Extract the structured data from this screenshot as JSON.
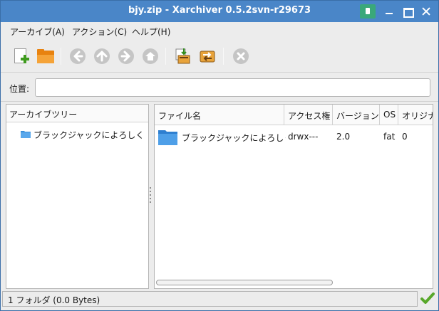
{
  "window": {
    "title": "bjy.zip - Xarchiver 0.5.2svn-r29673"
  },
  "menu": {
    "items": [
      "アーカイブ(A)",
      "アクション(C)",
      "ヘルプ(H)"
    ]
  },
  "toolbar": {
    "buttons": [
      {
        "name": "new-archive",
        "icon": "new-document-plus-icon",
        "enabled": true
      },
      {
        "name": "open-archive",
        "icon": "folder-open-icon",
        "enabled": true
      },
      {
        "name": "back",
        "icon": "arrow-left-icon",
        "enabled": false
      },
      {
        "name": "up",
        "icon": "arrow-up-icon",
        "enabled": false
      },
      {
        "name": "forward",
        "icon": "arrow-right-icon",
        "enabled": false
      },
      {
        "name": "home",
        "icon": "home-icon",
        "enabled": false
      },
      {
        "name": "extract",
        "icon": "extract-icon",
        "enabled": true
      },
      {
        "name": "convert",
        "icon": "convert-icon",
        "enabled": true
      },
      {
        "name": "stop",
        "icon": "stop-icon",
        "enabled": false
      }
    ]
  },
  "location": {
    "label": "位置:",
    "value": ""
  },
  "tree": {
    "header": "アーカイブツリー",
    "items": [
      {
        "label": "ブラックジャックによろしく",
        "icon": "folder-icon"
      }
    ]
  },
  "filelist": {
    "columns": [
      "ファイル名",
      "アクセス権",
      "バージョン",
      "OS",
      "オリジナル"
    ],
    "rows": [
      {
        "name": "ブラックジャックによろしく",
        "permissions": "drwx---",
        "version": "2.0",
        "os": "fat",
        "original": "0",
        "icon": "folder-icon"
      }
    ]
  },
  "status": {
    "text": "1 フォルダ  (0.0 Bytes)",
    "icon": "checkmark-icon"
  },
  "colors": {
    "titlebar": "#4a86c8",
    "folder_accent": "#e8820f",
    "status_ok": "#58a82a"
  }
}
